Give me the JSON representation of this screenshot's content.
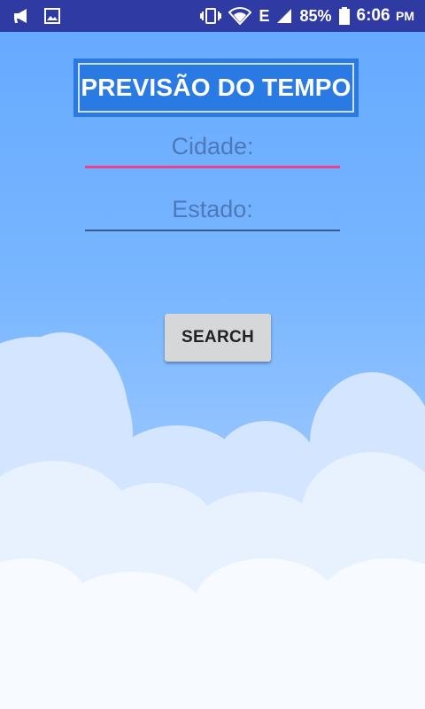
{
  "status_bar": {
    "battery": "85%",
    "time": "6:06",
    "ampm": "PM",
    "network_type": "E",
    "icons": [
      "megaphone-icon",
      "image-icon",
      "vibrate-icon",
      "wifi-icon",
      "signal-icon",
      "battery-icon"
    ]
  },
  "header": {
    "title": "PREVISÃO DO TEMPO"
  },
  "form": {
    "city": {
      "placeholder": "Cidade:",
      "value": ""
    },
    "state": {
      "placeholder": "Estado:",
      "value": ""
    },
    "search_label": "SEARCH"
  },
  "colors": {
    "status_bar": "#2f3aa3",
    "title_bg": "#2a7ae4",
    "focus_underline": "#e8438d",
    "button_bg": "#d6d7d9"
  }
}
